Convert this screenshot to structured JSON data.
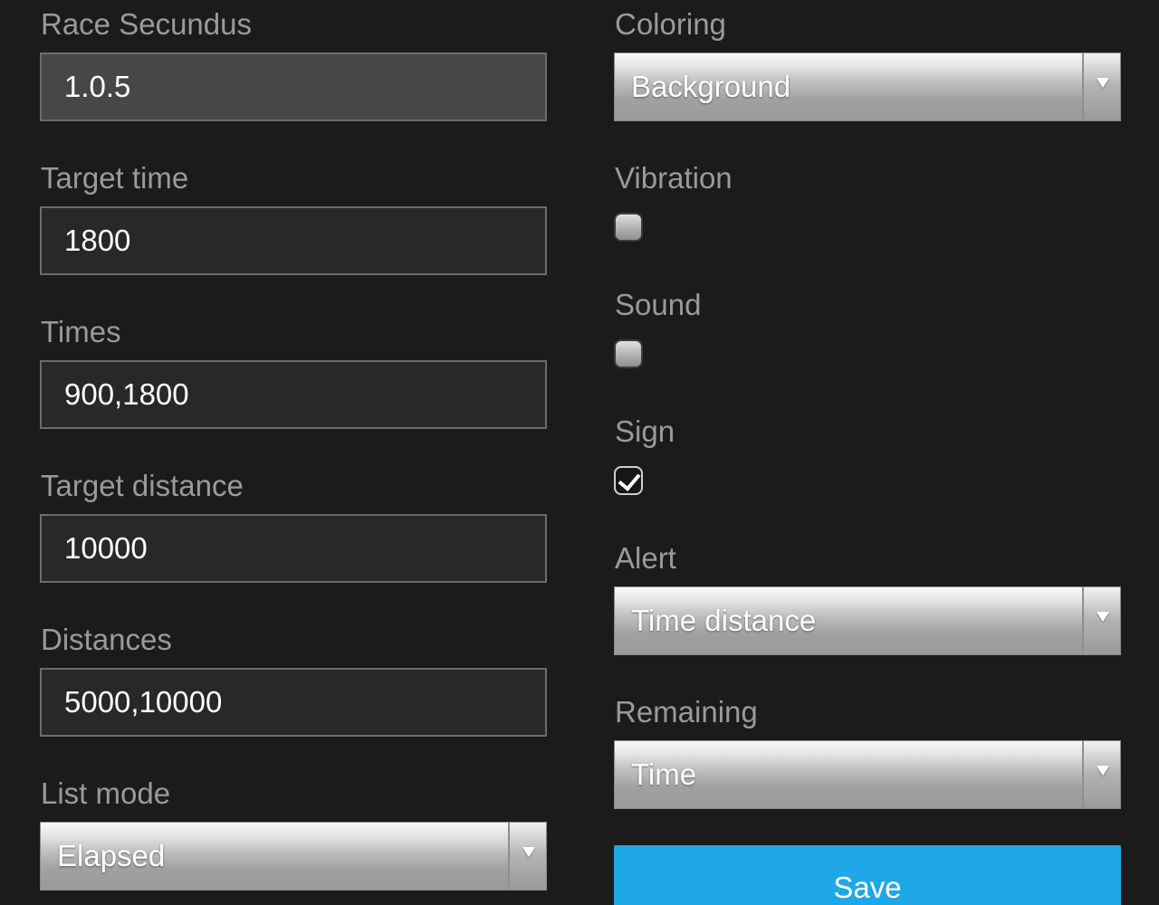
{
  "left_column": {
    "race_secundus": {
      "label": "Race Secundus",
      "value": "1.0.5"
    },
    "target_time": {
      "label": "Target time",
      "value": "1800"
    },
    "times": {
      "label": "Times",
      "value": "900,1800"
    },
    "target_distance": {
      "label": "Target distance",
      "value": "10000"
    },
    "distances": {
      "label": "Distances",
      "value": "5000,10000"
    },
    "list_mode": {
      "label": "List mode",
      "selected": "Elapsed",
      "icon": "chevron-down-icon"
    }
  },
  "right_column": {
    "coloring": {
      "label": "Coloring",
      "selected": "Background",
      "icon": "chevron-down-icon"
    },
    "vibration": {
      "label": "Vibration",
      "checked": false
    },
    "sound": {
      "label": "Sound",
      "checked": false
    },
    "sign": {
      "label": "Sign",
      "checked": true
    },
    "alert": {
      "label": "Alert",
      "selected": "Time distance",
      "icon": "chevron-down-icon"
    },
    "remaining": {
      "label": "Remaining",
      "selected": "Time",
      "icon": "chevron-down-icon"
    },
    "save_label": "Save"
  },
  "colors": {
    "background": "#1b1b1b",
    "label": "#9a9a9a",
    "field_background": "#282828",
    "field_active_background": "#474747",
    "save_button": "#1ea8e8"
  }
}
